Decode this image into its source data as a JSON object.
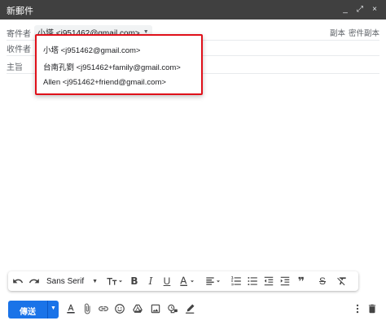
{
  "window": {
    "title": "新郵件",
    "minimize": "_",
    "expand": "⤢",
    "close": "×"
  },
  "from": {
    "label": "寄件者",
    "value": "小塔 <j951462@gmail.com>"
  },
  "cc_links": {
    "cc": "副本",
    "bcc": "密件副本"
  },
  "to": {
    "label": "收件者"
  },
  "subject": {
    "label": "主旨"
  },
  "dropdown": {
    "items": [
      "小塔 <j951462@gmail.com>",
      "台南孔劉 <j951462+family@gmail.com>",
      "Allen <j951462+friend@gmail.com>"
    ],
    "highlight_color": "#e0101a"
  },
  "toolbar": {
    "font_family": "Sans Serif",
    "quote_icon": "❞",
    "strike_label": "S"
  },
  "bottom": {
    "send_label": "傳送",
    "accent": "#1a73e8"
  }
}
